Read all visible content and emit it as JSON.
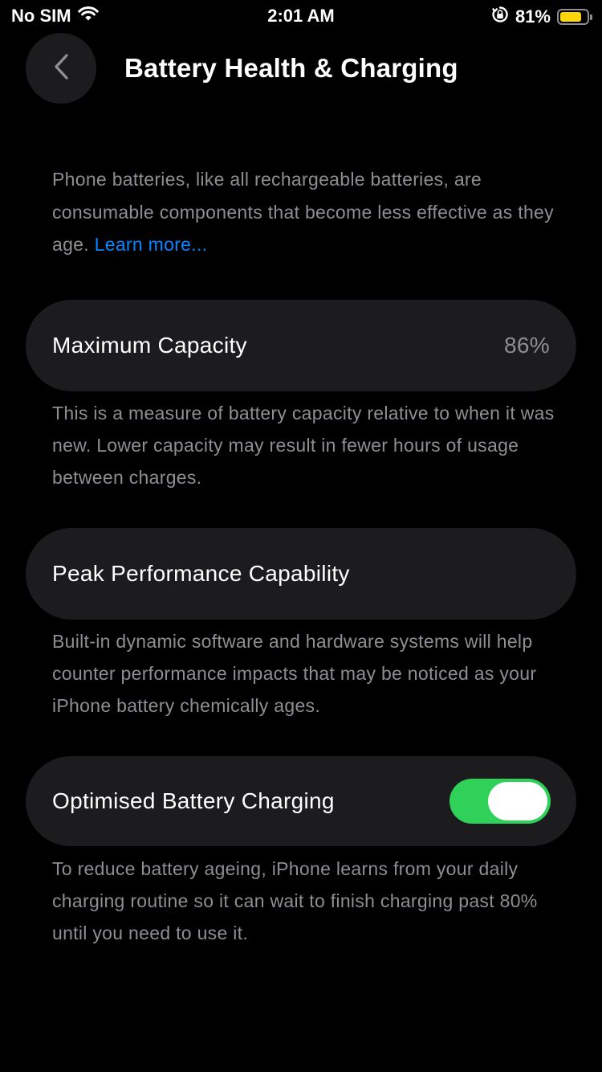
{
  "status_bar": {
    "carrier": "No SIM",
    "wifi_icon": "wifi-icon",
    "time": "2:01 AM",
    "rotation_lock_icon": "rotation-lock-icon",
    "battery_percent": "81%",
    "battery_level": 0.81,
    "battery_color": "#ffd60a"
  },
  "nav": {
    "back_icon": "chevron-left-icon",
    "title": "Battery Health & Charging"
  },
  "intro": {
    "text": "Phone batteries, like all rechargeable batteries, are consumable components that become less effective as they age. ",
    "link": "Learn more..."
  },
  "maximum_capacity": {
    "label": "Maximum Capacity",
    "value": "86%",
    "description": "This is a measure of battery capacity relative to when it was new. Lower capacity may result in fewer hours of usage between charges."
  },
  "peak_performance": {
    "label": "Peak Performance Capability",
    "description": "Built-in dynamic software and hardware systems will help counter performance impacts that may be noticed as your iPhone battery chemically ages."
  },
  "optimised_charging": {
    "label": "Optimised Battery Charging",
    "enabled": true,
    "toggle_color": "#30d158",
    "description": "To reduce battery ageing, iPhone learns from your daily charging routine so it can wait to finish charging past 80% until you need to use it."
  }
}
